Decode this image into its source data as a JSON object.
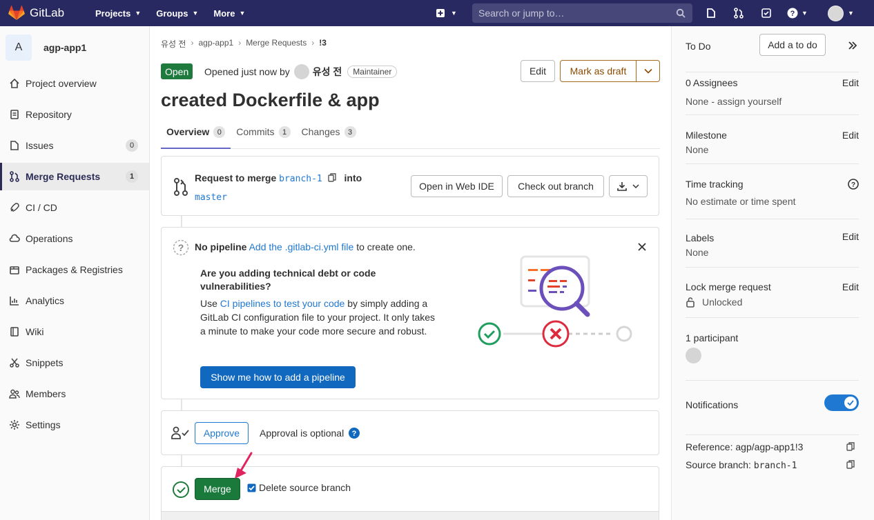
{
  "topbar": {
    "brand": "GitLab",
    "nav": [
      "Projects",
      "Groups",
      "More"
    ],
    "search_placeholder": "Search or jump to…"
  },
  "sidebar": {
    "project_initial": "A",
    "project_name": "agp-app1",
    "items": [
      {
        "label": "Project overview",
        "icon": "home-icon"
      },
      {
        "label": "Repository",
        "icon": "doc-icon"
      },
      {
        "label": "Issues",
        "icon": "issues-icon",
        "badge": "0"
      },
      {
        "label": "Merge Requests",
        "icon": "merge-request-icon",
        "badge": "1",
        "active": true
      },
      {
        "label": "CI / CD",
        "icon": "rocket-icon"
      },
      {
        "label": "Operations",
        "icon": "cloud-gear-icon"
      },
      {
        "label": "Packages & Registries",
        "icon": "package-icon"
      },
      {
        "label": "Analytics",
        "icon": "chart-icon"
      },
      {
        "label": "Wiki",
        "icon": "book-icon"
      },
      {
        "label": "Snippets",
        "icon": "scissors-icon"
      },
      {
        "label": "Members",
        "icon": "users-icon"
      },
      {
        "label": "Settings",
        "icon": "gear-icon"
      }
    ]
  },
  "main": {
    "breadcrumbs": [
      "유성 전",
      "agp-app1",
      "Merge Requests",
      "!3"
    ],
    "status": "Open",
    "opened_text": "Opened just now by",
    "author": "유성 전",
    "role": "Maintainer",
    "edit_label": "Edit",
    "draft_label": "Mark as draft",
    "title": "created Dockerfile & app",
    "tabs": [
      {
        "label": "Overview",
        "count": "0"
      },
      {
        "label": "Commits",
        "count": "1"
      },
      {
        "label": "Changes",
        "count": "3"
      }
    ],
    "merge_info": {
      "prefix": "Request to merge",
      "source": "branch-1",
      "into": "into",
      "target": "master",
      "web_ide": "Open in Web IDE",
      "checkout": "Check out branch"
    },
    "pipeline": {
      "title": "No pipeline",
      "link": "Add the .gitlab-ci.yml file",
      "suffix": "to create one.",
      "heading": "Are you adding technical debt or code vulnerabilities?",
      "body_pre": "Use",
      "body_link": "CI pipelines to test your code",
      "body_post": "by simply adding a GitLab CI configuration file to your project. It only takes a minute to make your code more secure and robust.",
      "button": "Show me how to add a pipeline"
    },
    "approval": {
      "button": "Approve",
      "text": "Approval is optional"
    },
    "merge": {
      "button": "Merge",
      "checkbox_label": "Delete source branch",
      "checked": true
    }
  },
  "right": {
    "todo_label": "To Do",
    "todo_button": "Add a to do",
    "assignees_label": "0 Assignees",
    "assignees_value": "None - assign yourself",
    "milestone_label": "Milestone",
    "milestone_value": "None",
    "time_label": "Time tracking",
    "time_value": "No estimate or time spent",
    "labels_label": "Labels",
    "labels_value": "None",
    "lock_label": "Lock merge request",
    "lock_value": "Unlocked",
    "participants_label": "1 participant",
    "notifications_label": "Notifications",
    "notifications_on": true,
    "reference": "Reference: agp/agp-app1!3",
    "source_branch_label": "Source branch:",
    "source_branch": "branch-1",
    "edit": "Edit"
  },
  "colors": {
    "navbar": "#292961",
    "open_badge": "#1f7a3e",
    "link": "#1f78d1",
    "merge": "#1a7a3c",
    "arrow": "#e0245e"
  }
}
